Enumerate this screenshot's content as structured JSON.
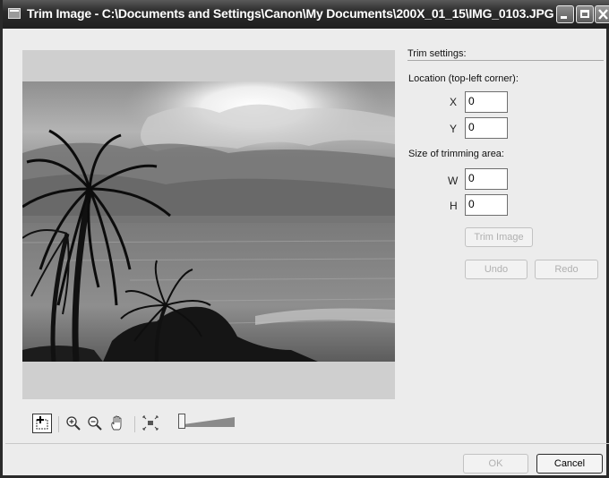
{
  "window": {
    "title": "Trim Image - C:\\Documents and Settings\\Canon\\My Documents\\200X_01_15\\IMG_0103.JPG",
    "controls": [
      "minimize-icon",
      "maximize-icon",
      "close-icon"
    ]
  },
  "trim_settings": {
    "heading": "Trim settings:",
    "location_label": "Location (top-left corner):",
    "x_label": "X",
    "x_value": "0",
    "y_label": "Y",
    "y_value": "0",
    "size_label": "Size of trimming area:",
    "w_label": "W",
    "w_value": "0",
    "h_label": "H",
    "h_value": "0"
  },
  "buttons": {
    "trim_image": "Trim Image",
    "undo": "Undo",
    "redo": "Redo",
    "ok": "OK",
    "cancel": "Cancel"
  },
  "toolbar": {
    "tools": [
      "select-area-icon",
      "zoom-in-icon",
      "zoom-out-icon",
      "hand-pan-icon",
      "fit-to-window-icon"
    ],
    "zoom_slider_level": 0
  },
  "colors": {
    "titlebar": "#2b2b2b",
    "dialog_bg": "#ececec",
    "disabled_text": "#b0b0b0"
  }
}
